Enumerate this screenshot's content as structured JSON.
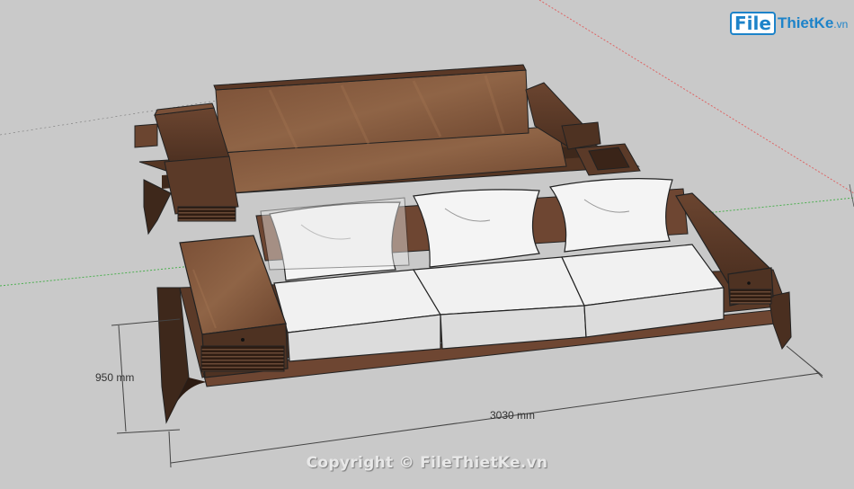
{
  "watermark": {
    "logo_file": "File",
    "logo_rest": "ThietKe",
    "logo_tld": ".vn"
  },
  "dimensions": {
    "depth_label": "950 mm",
    "width_label": "3030 mm"
  },
  "copyright": "Copyright © FileThietKe.vn",
  "colors": {
    "background": "#c9c9c9",
    "wood_dark": "#4e3222",
    "wood_mid": "#6b4530",
    "wood_light": "#8a5e42",
    "cushion": "#ececec",
    "accent_blue": "#1d83c9"
  },
  "objects": [
    "back-view sofa set",
    "front-view sofa set",
    "cushions",
    "pillows",
    "side tables"
  ]
}
